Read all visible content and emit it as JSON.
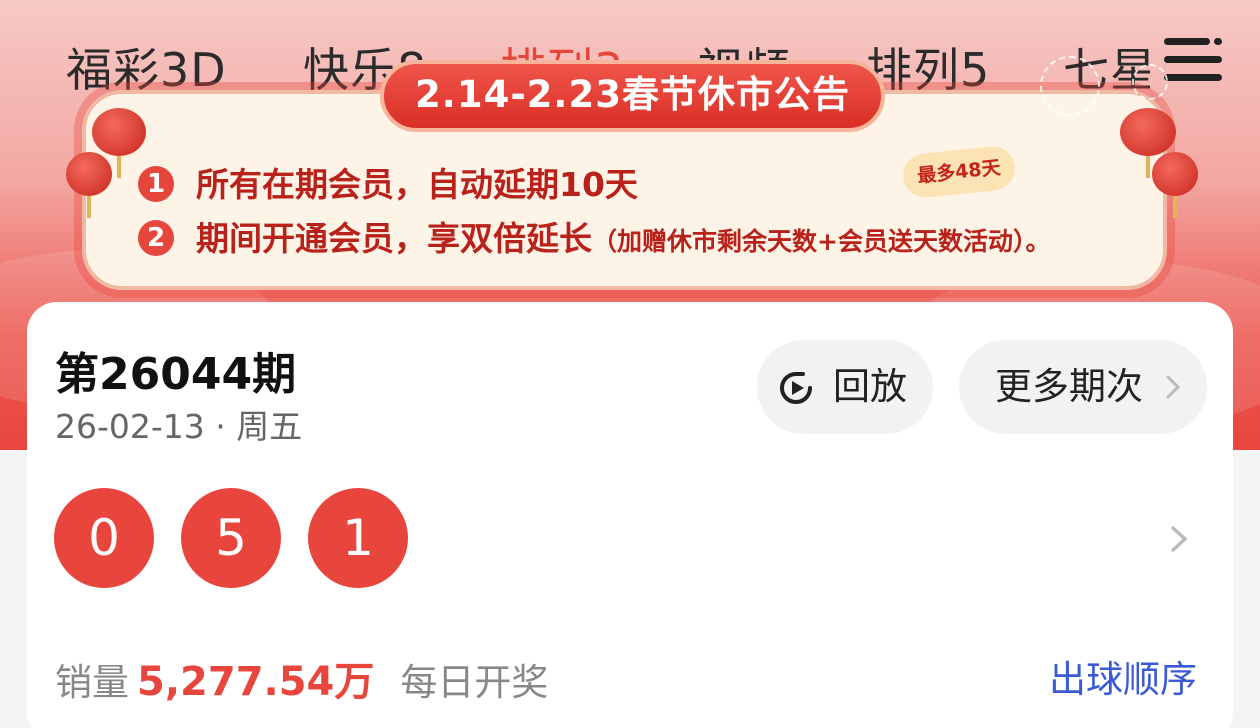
{
  "tabs": [
    {
      "label": "福彩3D",
      "active": false
    },
    {
      "label": "快乐8",
      "active": false
    },
    {
      "label": "排列3",
      "active": true
    },
    {
      "label": "视频",
      "active": false
    },
    {
      "label": "排列5",
      "active": false
    },
    {
      "label": "七星彩",
      "active": false
    }
  ],
  "menu_icon": "hamburger-menu-icon",
  "banner": {
    "title": "2.14-2.23春节休市公告",
    "items": [
      {
        "num": "1",
        "text": "所有在期会员，自动延期10天",
        "note": ""
      },
      {
        "num": "2",
        "text": "期间开通会员，享双倍延长",
        "note": "（加赠休市剩余天数+会员送天数活动）。"
      }
    ],
    "badge": "最多48天"
  },
  "draw": {
    "issue": "第26044期",
    "date": "26-02-13 · 周五",
    "replay_label": "回放",
    "more_label": "更多期次",
    "numbers": [
      "0",
      "5",
      "1"
    ],
    "sales_label": "销量",
    "sales_amount": "5,277.54万",
    "frequency": "每日开奖",
    "order_link": "出球顺序"
  },
  "colors": {
    "accent": "#e8453d",
    "link": "#3b5bd6"
  }
}
